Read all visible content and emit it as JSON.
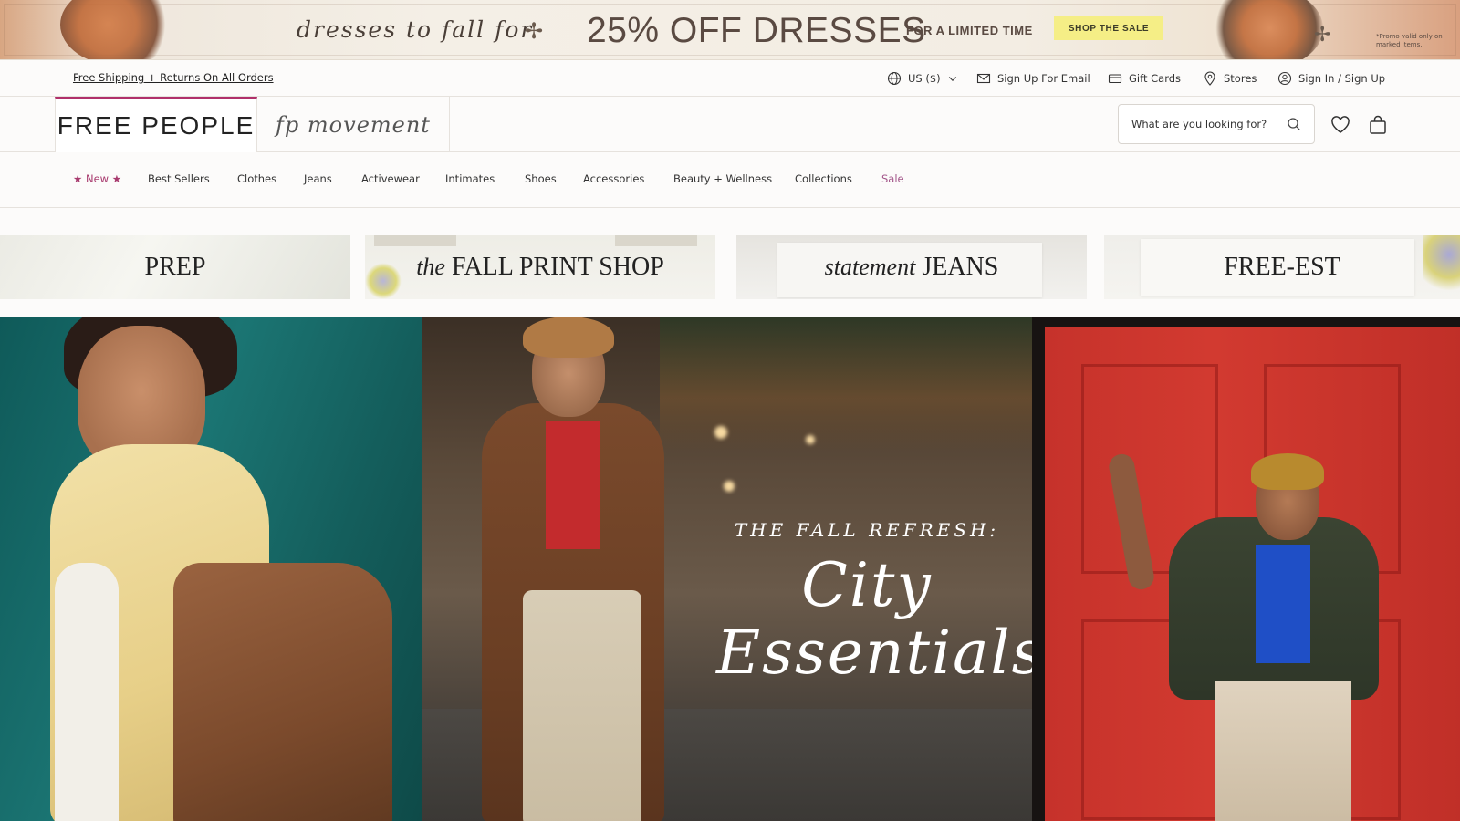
{
  "promo": {
    "script_text": "dresses to fall for",
    "headline": "25% OFF DRESSES",
    "subtext": "FOR A LIMITED TIME",
    "cta": "SHOP THE SALE",
    "fine_print": "*Promo valid only on marked items."
  },
  "utility": {
    "shipping": "Free Shipping + Returns On All Orders",
    "currency": "US ($)",
    "email": "Sign Up For Email",
    "gift_cards": "Gift Cards",
    "stores": "Stores",
    "account": "Sign In / Sign Up"
  },
  "brands": {
    "main": "FREE PEOPLE",
    "movement": "fp movement"
  },
  "search": {
    "placeholder": "What are you looking for?"
  },
  "nav": {
    "items": [
      "★ New ★",
      "Best Sellers",
      "Clothes",
      "Jeans",
      "Activewear",
      "Intimates",
      "Shoes",
      "Accessories",
      "Beauty + Wellness",
      "Collections",
      "Sale"
    ]
  },
  "tiles": [
    {
      "prefix": "",
      "label": "PREP"
    },
    {
      "prefix": "the",
      "label": "FALL PRINT SHOP"
    },
    {
      "prefix": "statement",
      "label": "JEANS"
    },
    {
      "prefix": "",
      "label": "FREE-EST"
    }
  ],
  "hero": {
    "kicker": "THE FALL REFRESH:",
    "title_line1": "City",
    "title_line2": "Essentials"
  },
  "colors": {
    "accent": "#b0306a",
    "sale": "#a3568a",
    "cta_bg": "#f5ee86"
  }
}
